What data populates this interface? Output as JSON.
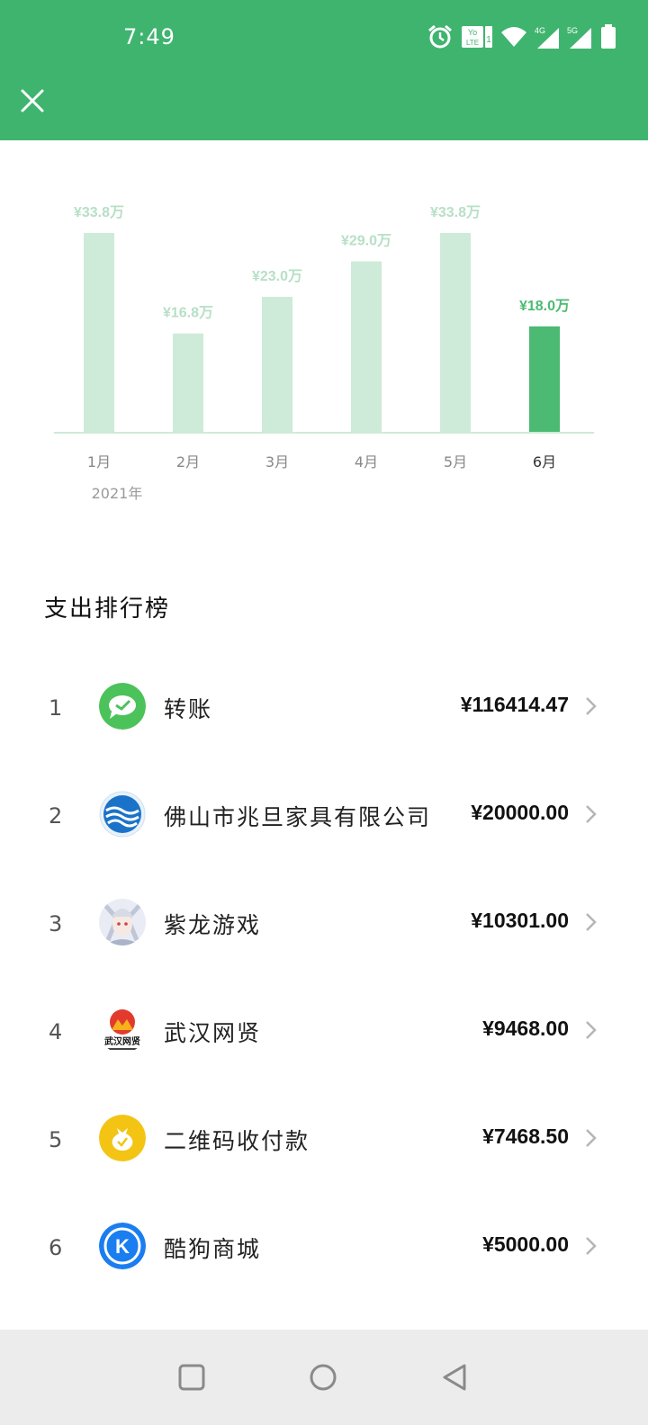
{
  "status": {
    "time": "7:49",
    "icons": [
      "alarm-icon",
      "volte-icon",
      "wifi-icon",
      "signal-4g-icon",
      "signal-5g-icon",
      "battery-icon"
    ],
    "volte_label_top": "Yo",
    "volte_label_bottom": "LTE",
    "volte_sim": "1",
    "net1": "4G",
    "net2": "5G"
  },
  "header": {
    "close_icon": "close-icon",
    "color": "#3fb46f"
  },
  "chart_data": {
    "type": "bar",
    "categories": [
      "1月",
      "2月",
      "3月",
      "4月",
      "5月",
      "6月"
    ],
    "values": [
      33.8,
      16.8,
      23.0,
      29.0,
      33.8,
      18.0
    ],
    "value_labels": [
      "¥33.8万",
      "¥16.8万",
      "¥23.0万",
      "¥29.0万",
      "¥33.8万",
      "¥18.0万"
    ],
    "selected_index": 5,
    "year_label": "2021年",
    "ylim": [
      0,
      33.8
    ],
    "bar_color": "#cdebd8",
    "selected_color": "#4cba72",
    "label_color": "#b7e0c6",
    "selected_label_color": "#4cba72"
  },
  "ranking": {
    "title": "支出排行榜",
    "items": [
      {
        "rank": "1",
        "name": "转账",
        "amount": "¥116414.47",
        "icon": "transfer-icon"
      },
      {
        "rank": "2",
        "name": "佛山市兆旦家具有限公司",
        "amount": "¥20000.00",
        "icon": "company-logo-icon"
      },
      {
        "rank": "3",
        "name": "紫龙游戏",
        "amount": "¥10301.00",
        "icon": "game-avatar-icon"
      },
      {
        "rank": "4",
        "name": "武汉网贤",
        "amount": "¥9468.00",
        "icon": "wuhan-wangxian-logo-icon"
      },
      {
        "rank": "5",
        "name": "二维码收付款",
        "amount": "¥7468.50",
        "icon": "qr-payment-icon"
      },
      {
        "rank": "6",
        "name": "酷狗商城",
        "amount": "¥5000.00",
        "icon": "kugou-icon"
      }
    ]
  },
  "logo_text": {
    "wuhan": "武汉网贤",
    "kugou": "K"
  },
  "nav": {
    "icons": [
      "recents-icon",
      "home-icon",
      "back-icon"
    ]
  }
}
